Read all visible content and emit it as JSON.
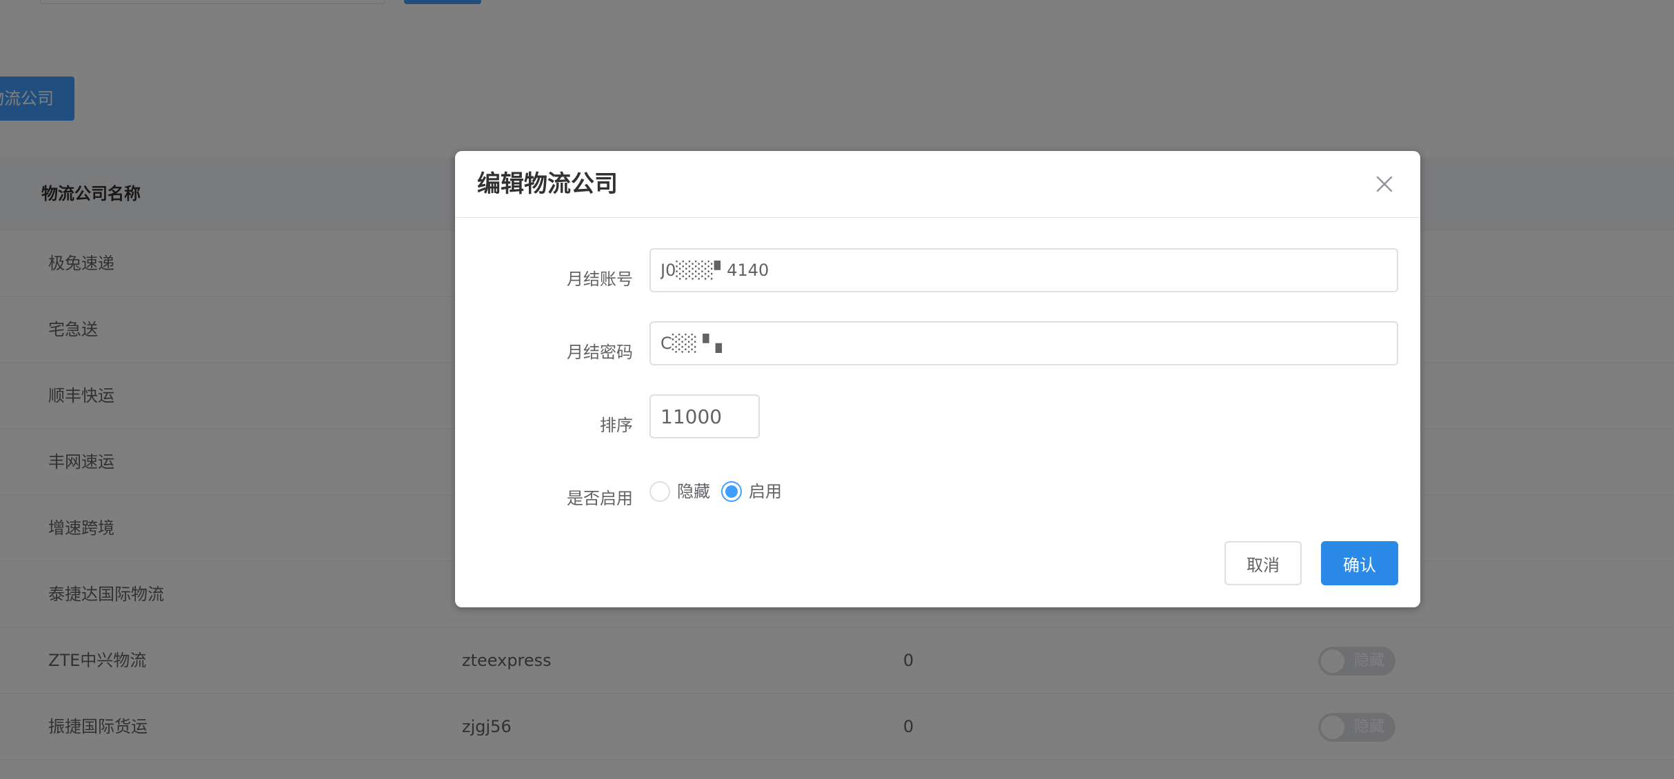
{
  "toolbar": {
    "add_label": "物流公司"
  },
  "table": {
    "header_name": "物流公司名称",
    "rows": [
      {
        "name": "极兔速递"
      },
      {
        "name": "宅急送"
      },
      {
        "name": "顺丰快运"
      },
      {
        "name": "丰网速运"
      },
      {
        "name": "增速跨境"
      },
      {
        "name": "泰捷达国际物流"
      },
      {
        "name": "ZTE中兴物流",
        "code": "zteexpress",
        "sort": "0",
        "status": "隐藏"
      },
      {
        "name": "振捷国际货运",
        "code": "zjgj56",
        "sort": "0",
        "status": "隐藏"
      }
    ]
  },
  "dialog": {
    "title": "编辑物流公司",
    "account_label": "月结账号",
    "account_value": "J0░░░▘4140",
    "password_label": "月结密码",
    "password_value": "C░░ ▘▖",
    "sort_label": "排序",
    "sort_value": "11000",
    "enabled_label": "是否启用",
    "radio_hide": "隐藏",
    "radio_enable": "启用",
    "cancel_label": "取消",
    "confirm_label": "确认"
  },
  "colors": {
    "primary": "#409eff",
    "confirm": "#2b8ae8"
  }
}
